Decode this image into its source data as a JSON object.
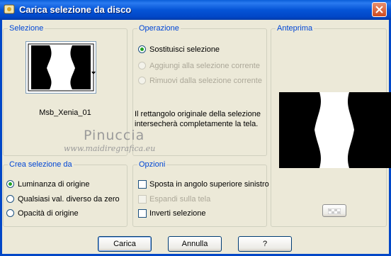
{
  "window": {
    "title": "Carica selezione da disco",
    "close_icon": "close-icon",
    "app_icon": "psp-icon"
  },
  "selezione": {
    "legend": "Selezione",
    "thumbnail_name": "Msb_Xenia_01",
    "dropdown_icon": "chevron-down-icon"
  },
  "operazione": {
    "legend": "Operazione",
    "options": [
      {
        "label": "Sostituisci selezione",
        "checked": true,
        "enabled": true
      },
      {
        "label": "Aggiungi alla selezione corrente",
        "checked": false,
        "enabled": false
      },
      {
        "label": "Rimuovi dalla selezione corrente",
        "checked": false,
        "enabled": false
      }
    ],
    "info_line1": "Il rettangolo originale della selezione",
    "info_line2": "intersecherà completamente la tela."
  },
  "anteprima": {
    "legend": "Anteprima"
  },
  "crea": {
    "legend": "Crea selezione da",
    "options": [
      {
        "label": "Luminanza di origine",
        "checked": true
      },
      {
        "label": "Qualsiasi val. diverso da zero",
        "checked": false
      },
      {
        "label": "Opacità di origine",
        "checked": false
      }
    ]
  },
  "opzioni": {
    "legend": "Opzioni",
    "items": [
      {
        "label": "Sposta in angolo superiore sinistro",
        "checked": false,
        "enabled": true
      },
      {
        "label": "Espandi sulla tela",
        "checked": false,
        "enabled": false
      },
      {
        "label": "Inverti selezione",
        "checked": false,
        "enabled": true
      }
    ]
  },
  "watermark": {
    "line1": "Pinuccia",
    "line2": "www.maidiregrafica.eu"
  },
  "buttons": {
    "ok": "Carica",
    "cancel": "Annulla",
    "help": "?"
  },
  "colors": {
    "titlebar": "#0554d6",
    "legend": "#0046d5",
    "dialog_bg": "#ece9d8",
    "radio_dot": "#21a121"
  }
}
